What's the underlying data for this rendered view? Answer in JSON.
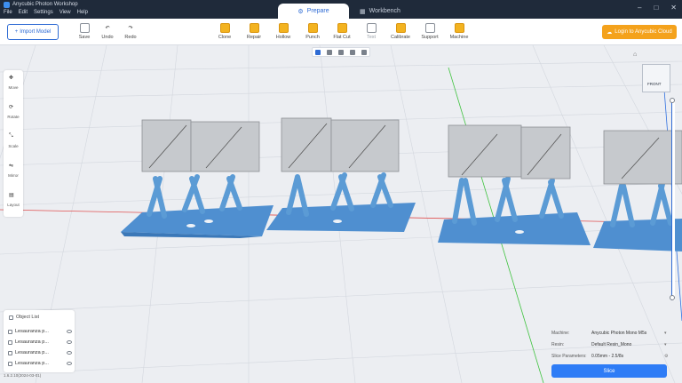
{
  "app": {
    "title": "Anycubic Photon Workshop"
  },
  "menu": [
    "File",
    "Edit",
    "Settings",
    "View",
    "Help"
  ],
  "tabs": [
    {
      "label": "Prepare",
      "icon": "gear-cube-icon",
      "active": true
    },
    {
      "label": "Workbench",
      "icon": "grid-icon",
      "active": false
    }
  ],
  "toolbar": {
    "import_label": "Import Model",
    "left_buttons": [
      {
        "label": "Save",
        "icon": "save-icon"
      },
      {
        "label": "Undo",
        "icon": "undo-icon"
      },
      {
        "label": "Redo",
        "icon": "redo-icon"
      }
    ],
    "tools": [
      {
        "label": "Clone",
        "icon": "clone-icon",
        "enabled": true
      },
      {
        "label": "Repair",
        "icon": "repair-icon",
        "enabled": true
      },
      {
        "label": "Hollow",
        "icon": "hollow-icon",
        "enabled": true
      },
      {
        "label": "Punch",
        "icon": "punch-icon",
        "enabled": true
      },
      {
        "label": "Flat Cut",
        "icon": "flat-cut-icon",
        "enabled": true
      },
      {
        "label": "Text",
        "icon": "text-icon",
        "enabled": false
      },
      {
        "label": "Calibrate",
        "icon": "calibrate-icon",
        "enabled": true
      },
      {
        "label": "Support",
        "icon": "support-icon",
        "enabled": true
      },
      {
        "label": "Machine",
        "icon": "machine-icon",
        "enabled": true
      }
    ],
    "login_label": "Login to Anycubic Cloud"
  },
  "left_tools": [
    {
      "label": "Move",
      "icon": "move-icon"
    },
    {
      "label": "Rotate",
      "icon": "rotate-icon"
    },
    {
      "label": "Scale",
      "icon": "scale-icon"
    },
    {
      "label": "Mirror",
      "icon": "mirror-icon"
    },
    {
      "label": "Layout",
      "icon": "layout-icon"
    }
  ],
  "viewcube": {
    "label": "FRONT"
  },
  "objects": {
    "header": "Object List",
    "items": [
      "Lesauranza p...",
      "Lesauranza p...",
      "Lesauranza p...",
      "Lesauranza p..."
    ]
  },
  "status": "1.6.2.10(2024-03-01)",
  "settings": {
    "machine_label": "Machine:",
    "machine_value": "Anycubic Photon Mono M5s",
    "resin_label": "Resin:",
    "resin_value": "Default Resin_Mono",
    "slice_params_label": "Slice Parameters:",
    "slice_params_value": "0.05mm   -   2.5/8s"
  },
  "slice_label": "Slice",
  "colors": {
    "accent": "#2e7cf6",
    "login": "#f4a21c",
    "model": "#c6c9cd",
    "support": "#5b9bd5"
  }
}
